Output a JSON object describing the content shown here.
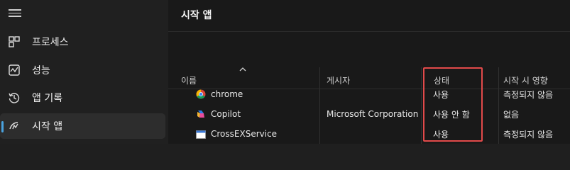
{
  "sidebar": {
    "items": [
      {
        "label": "프로세스",
        "icon": "processes-icon"
      },
      {
        "label": "성능",
        "icon": "performance-icon"
      },
      {
        "label": "앱 기록",
        "icon": "app-history-icon"
      },
      {
        "label": "시작 앱",
        "icon": "startup-apps-icon",
        "active": true
      }
    ]
  },
  "main": {
    "title": "시작 앱",
    "columns": {
      "name": "이름",
      "publisher": "게시자",
      "status": "상태",
      "impact": "시작 시 영향"
    },
    "rows": [
      {
        "name": "chrome",
        "publisher": "",
        "status": "사용",
        "impact": "측정되지 않음",
        "icon": "chrome-icon"
      },
      {
        "name": "Copilot",
        "publisher": "Microsoft Corporation",
        "status": "사용 안 함",
        "impact": "없음",
        "icon": "copilot-icon"
      },
      {
        "name": "CrossEXService",
        "publisher": "",
        "status": "사용",
        "impact": "측정되지 않음",
        "icon": "crossex-icon"
      }
    ]
  },
  "colors": {
    "accent": "#4aa3df",
    "highlight": "#e24a4a"
  }
}
